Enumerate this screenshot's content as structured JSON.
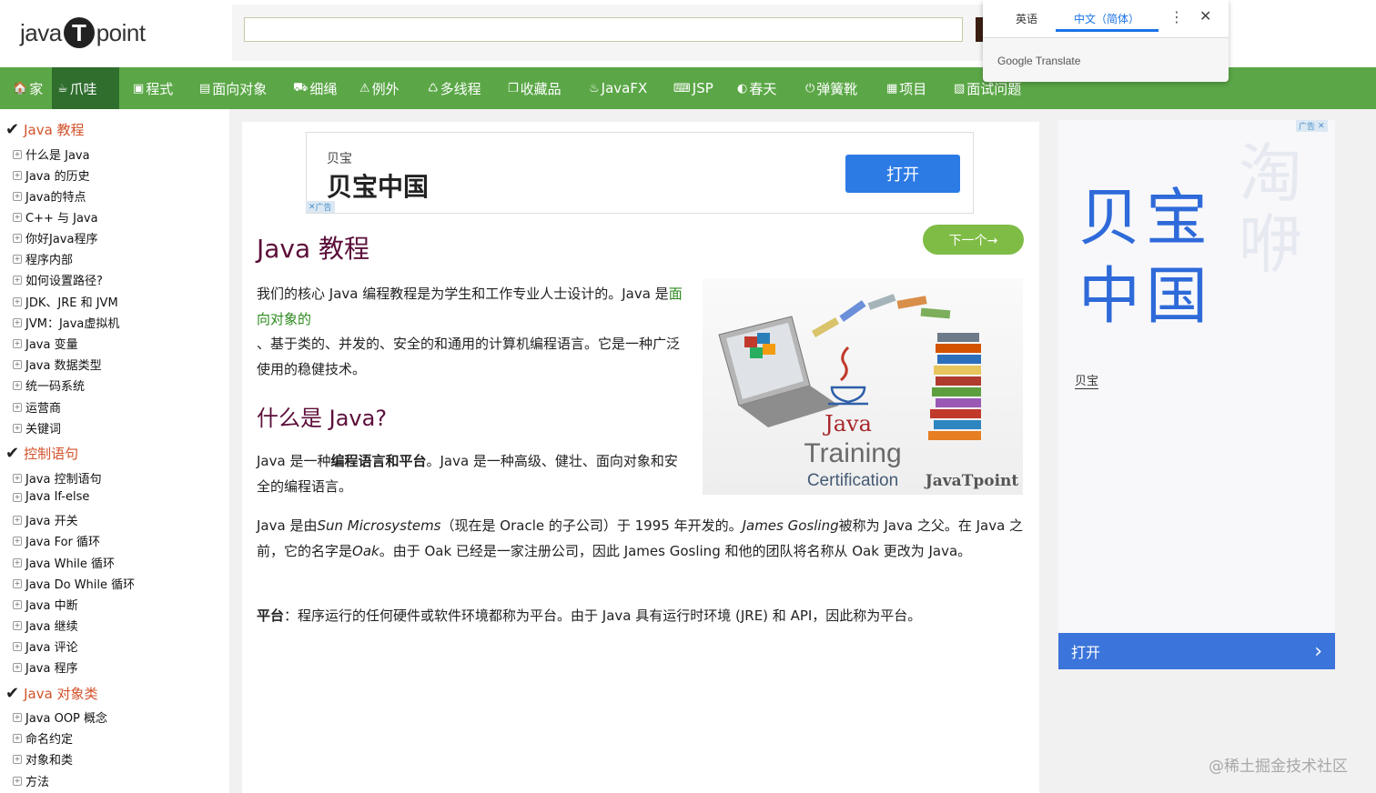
{
  "header": {
    "logo_left": "java",
    "logo_badge": "T",
    "logo_right": "point",
    "search_placeholder": ""
  },
  "translate_popup": {
    "tab_source": "英语",
    "tab_target": "中文（简体）",
    "more_icon": "⋮",
    "close_icon": "✕",
    "brand": "Google Translate"
  },
  "nav": {
    "items": [
      {
        "icon": "🏠",
        "label": "家"
      },
      {
        "icon": "☕",
        "label": "爪哇"
      },
      {
        "icon": "▣",
        "label": "程式"
      },
      {
        "icon": "▤",
        "label": "面向对象"
      },
      {
        "icon": "⛟",
        "label": "细绳"
      },
      {
        "icon": "⚠",
        "label": "例外"
      },
      {
        "icon": "♺",
        "label": "多线程"
      },
      {
        "icon": "❐",
        "label": "收藏品"
      },
      {
        "icon": "♨",
        "label": "JavaFX"
      },
      {
        "icon": "⌨",
        "label": "JSP"
      },
      {
        "icon": "◐",
        "label": "春天"
      },
      {
        "icon": "⏻",
        "label": "弹簧靴"
      },
      {
        "icon": "▦",
        "label": "项目"
      },
      {
        "icon": "▧",
        "label": "面试问题"
      }
    ]
  },
  "sidebar": {
    "sections": [
      {
        "title": "Java 教程",
        "items": [
          "什么是 Java",
          "Java 的历史",
          "Java的特点",
          "C++ 与 Java",
          "你好Java程序",
          "程序内部",
          "如何设置路径?",
          "JDK、JRE 和 JVM",
          "JVM：Java虚拟机",
          "Java 变量",
          "Java 数据类型",
          "统一码系统",
          "运营商",
          "关键词"
        ]
      },
      {
        "title": "控制语句",
        "items": [
          "Java 控制语句",
          "Java If-else",
          "Java 开关",
          "Java For 循环",
          "Java While 循环",
          "Java Do While 循环",
          "Java 中断",
          "Java 继续",
          "Java 评论",
          "Java 程序"
        ]
      },
      {
        "title": "Java 对象类",
        "items": [
          "Java OOP 概念",
          "命名约定",
          "对象和类",
          "方法"
        ]
      }
    ]
  },
  "top_ad": {
    "brand_small": "贝宝",
    "brand_big": "贝宝中国",
    "open_label": "打开",
    "close_mark": "✕",
    "ad_mark": "广告"
  },
  "content": {
    "title": "Java 教程",
    "next_label": "下一个→",
    "intro_before_link": "我们的核心 Java 编程教程是为学生和工作专业人士设计的。Java 是",
    "intro_link": "面向对象的",
    "intro_after_link": "、基于类的、并发的、安全的和通用的计算机编程语言。它是一种广泛使用的稳健技术。",
    "h2": "什么是 Java?",
    "what_p1": "Java 是一种",
    "what_bold": "编程语言和平台",
    "what_p2": "。Java 是一种高级、健壮、面向对象和安全的编程语言。",
    "history_1": "Java 是由",
    "history_sun": "Sun Microsystems",
    "history_2": "（现在是 Oracle 的子公司）于 1995 年开发的。",
    "history_gosling": "James Gosling",
    "history_3": "被称为 Java 之父。在 Java 之前，它的名字是",
    "history_oak": "Oak",
    "history_4": "。由于 Oak 已经是一家注册公司，因此 James Gosling 和他的团队将名称从 Oak 更改为 Java。",
    "platform_bold": "平台",
    "platform_text": "：程序运行的任何硬件或软件环境都称为平台。由于 Java 具有运行时环境 (JRE) 和 API，因此称为平台。"
  },
  "java_image": {
    "word_java": "Java",
    "word_training": "Training",
    "word_certification": "Certification",
    "word_brand": "JavaTpoint"
  },
  "right_ad": {
    "big_name": "贝宝中国",
    "ghost": "淘咿",
    "brand_small": "贝宝",
    "open_label": "打开",
    "chevron": "›",
    "ad_mark": "广告",
    "close_mark": "✕"
  },
  "watermark": "@稀土掘金技术社区",
  "colors": {
    "nav_green": "#5ba747",
    "nav_active": "#2f6e2d",
    "title_maroon": "#5c0f3a",
    "link_green": "#2b8a1c",
    "ad_blue": "#2e6ad9",
    "sidebar_section": "#d2522b"
  }
}
